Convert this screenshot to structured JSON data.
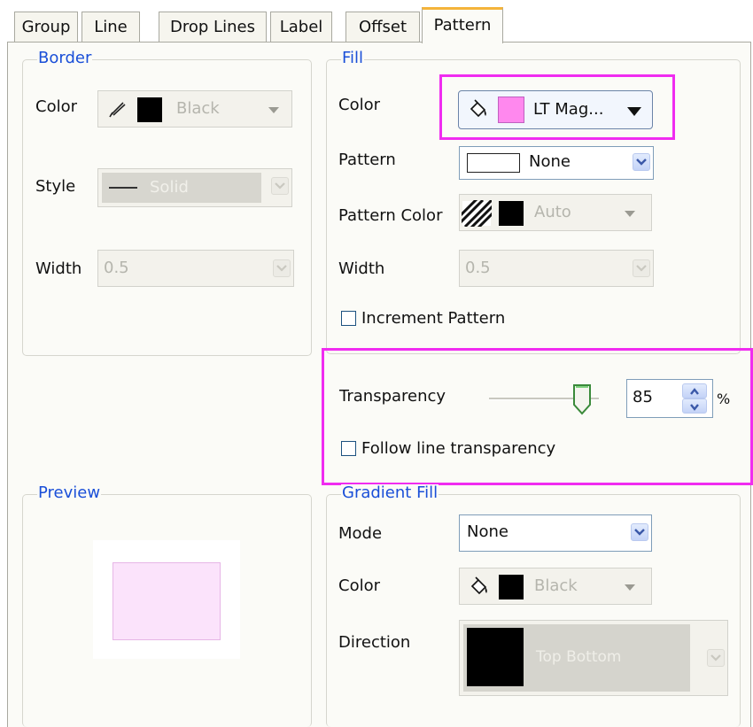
{
  "tabs": [
    {
      "label": "Group"
    },
    {
      "label": "Line"
    },
    {
      "label": "Drop Lines"
    },
    {
      "label": "Label"
    },
    {
      "label": "Offset"
    },
    {
      "label": "Pattern",
      "active": true
    }
  ],
  "border": {
    "legend": "Border",
    "color_label": "Color",
    "color_value": "Black",
    "style_label": "Style",
    "style_value": "Solid",
    "width_label": "Width",
    "width_value": "0.5"
  },
  "fill": {
    "legend": "Fill",
    "color_label": "Color",
    "color_value": "LT Mag...",
    "color_swatch": "#ff88ee",
    "pattern_label": "Pattern",
    "pattern_value": "None",
    "pattern_color_label": "Pattern Color",
    "pattern_color_value": "Auto",
    "width_label": "Width",
    "width_value": "0.5",
    "increment_label": "Increment Pattern",
    "increment_checked": false
  },
  "transparency": {
    "label": "Transparency",
    "value": "85",
    "unit": "%",
    "slider_fraction": 0.85,
    "follow_label": "Follow line transparency",
    "follow_checked": false
  },
  "preview": {
    "legend": "Preview",
    "fill_color": "#fbe3fb"
  },
  "gradient": {
    "legend": "Gradient Fill",
    "mode_label": "Mode",
    "mode_value": "None",
    "color_label": "Color",
    "color_value": "Black",
    "direction_label": "Direction",
    "direction_value": "Top Bottom"
  },
  "colors": {
    "highlight": "#f02cf0",
    "legend_text": "#1a4fd8",
    "tab_active_accent": "#f4b43a"
  }
}
